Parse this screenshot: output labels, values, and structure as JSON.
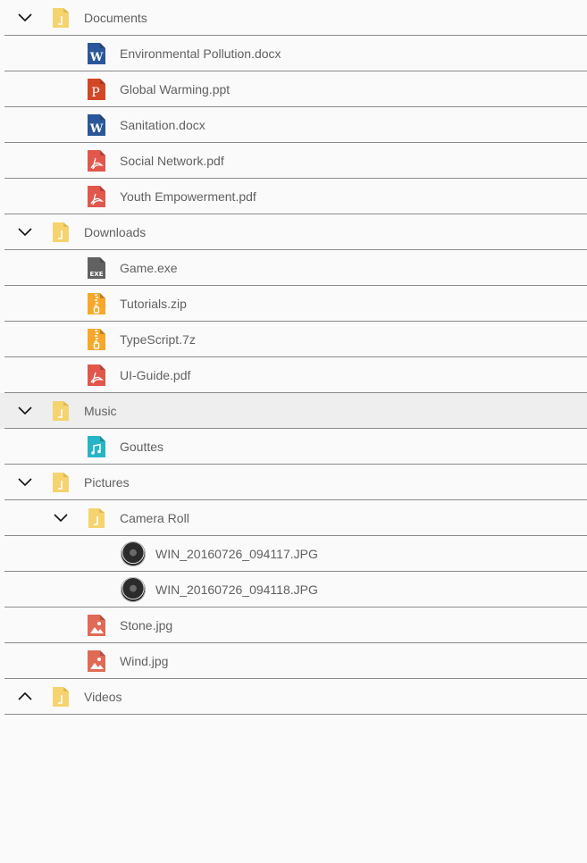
{
  "tree": [
    {
      "type": "folder",
      "label": "Documents",
      "expanded": true,
      "depth": 0,
      "icon": "folder-icon",
      "children": [
        {
          "type": "file",
          "label": "Environmental Pollution.docx",
          "icon": "word-icon"
        },
        {
          "type": "file",
          "label": "Global Warming.ppt",
          "icon": "powerpoint-icon"
        },
        {
          "type": "file",
          "label": "Sanitation.docx",
          "icon": "word-icon"
        },
        {
          "type": "file",
          "label": "Social Network.pdf",
          "icon": "pdf-icon"
        },
        {
          "type": "file",
          "label": "Youth Empowerment.pdf",
          "icon": "pdf-icon"
        }
      ]
    },
    {
      "type": "folder",
      "label": "Downloads",
      "expanded": true,
      "depth": 0,
      "icon": "folder-icon",
      "children": [
        {
          "type": "file",
          "label": "Game.exe",
          "icon": "exe-icon"
        },
        {
          "type": "file",
          "label": "Tutorials.zip",
          "icon": "zip-icon"
        },
        {
          "type": "file",
          "label": "TypeScript.7z",
          "icon": "zip-icon"
        },
        {
          "type": "file",
          "label": "UI-Guide.pdf",
          "icon": "pdf-icon"
        }
      ]
    },
    {
      "type": "folder",
      "label": "Music",
      "expanded": true,
      "highlighted": true,
      "depth": 0,
      "icon": "folder-icon",
      "children": [
        {
          "type": "file",
          "label": "Gouttes",
          "icon": "music-icon"
        }
      ]
    },
    {
      "type": "folder",
      "label": "Pictures",
      "expanded": true,
      "depth": 0,
      "icon": "folder-icon",
      "children": [
        {
          "type": "folder",
          "label": "Camera Roll",
          "expanded": true,
          "icon": "folder-icon",
          "children": [
            {
              "type": "file",
              "label": "WIN_20160726_094117.JPG",
              "icon": "photo-thumbnail"
            },
            {
              "type": "file",
              "label": "WIN_20160726_094118.JPG",
              "icon": "photo-thumbnail"
            }
          ]
        },
        {
          "type": "file",
          "label": "Stone.jpg",
          "icon": "image-icon"
        },
        {
          "type": "file",
          "label": "Wind.jpg",
          "icon": "image-icon"
        }
      ]
    },
    {
      "type": "folder",
      "label": "Videos",
      "expanded": false,
      "depth": 0,
      "icon": "folder-icon",
      "children": []
    }
  ],
  "colors": {
    "folder": "#f5d46f",
    "word": "#2b579a",
    "powerpoint": "#d24726",
    "pdf": "#e2574c",
    "exe": "#616161",
    "zip": "#f7a82b",
    "music": "#26b5c6",
    "image": "#e06a55",
    "divider": "#8a8a8a",
    "highlight": "#eeeeee"
  }
}
